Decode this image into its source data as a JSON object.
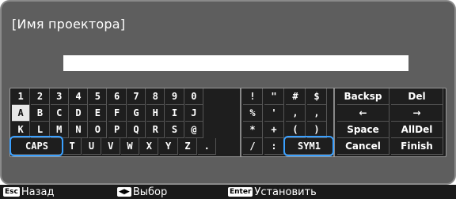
{
  "title": "[Имя проектора]",
  "entry_value": "",
  "rows": [
    [
      "1",
      "2",
      "3",
      "4",
      "5",
      "6",
      "7",
      "8",
      "9",
      "0"
    ],
    [
      "A",
      "B",
      "C",
      "D",
      "E",
      "F",
      "G",
      "H",
      "I",
      "J"
    ],
    [
      "K",
      "L",
      "M",
      "N",
      "O",
      "P",
      "Q",
      "R",
      "S",
      "@"
    ],
    [
      "CAPS",
      "T",
      "U",
      "V",
      "W",
      "X",
      "Y",
      "Z",
      "."
    ]
  ],
  "sym_rows": [
    [
      "!",
      "\"",
      "#",
      "$"
    ],
    [
      "%",
      "'",
      ",",
      ","
    ],
    [
      "*",
      "+",
      "(",
      ")"
    ],
    [
      "/",
      ":",
      "SYM1"
    ]
  ],
  "edit_rows": [
    [
      "Backsp",
      "Del"
    ],
    [
      "←",
      "→"
    ],
    [
      "Space",
      "AllDel"
    ],
    [
      "Cancel",
      "Finish"
    ]
  ],
  "selected": "A",
  "footer": {
    "back_tag": "Esc",
    "back_label": "Назад",
    "select_tag": "◀▶",
    "select_label": "Выбор",
    "enter_tag": "Enter",
    "enter_label": "Установить"
  },
  "colors": {
    "panel": "#5e5e5e",
    "keyboard": "#1e1e1e",
    "focus_ring": "#3aa0ff"
  }
}
